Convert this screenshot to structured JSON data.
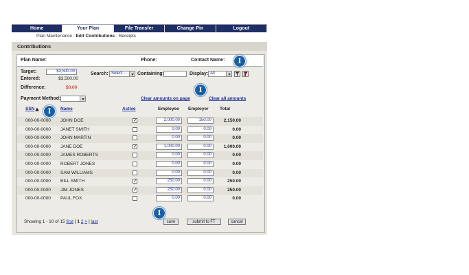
{
  "nav": {
    "tabs": [
      "Home",
      "Your Plan",
      "File Transfer",
      "Change Pin",
      "Logout"
    ],
    "active": "Your Plan"
  },
  "breadcrumb": {
    "prefix": "Plan Maintenance :",
    "current": "Edit Contributions",
    "suffix": ": Receipts"
  },
  "section_title": "Contributions",
  "plan": {
    "plan_name_label": "Plan Name:",
    "phone_label": "Phone:",
    "contact_label": "Contact Name:"
  },
  "summary": {
    "target_label": "Target:",
    "target_value": "$3,500.00",
    "entered_label": "Entered:",
    "entered_value": "$3,500.00",
    "difference_label": "Difference:",
    "difference_value": "$0.00",
    "difference_color": "#cc0000"
  },
  "filters": {
    "search_label": "Search:",
    "search_value": "Select....",
    "containing_label": "Containing:",
    "containing_value": "",
    "display_label": "Display:",
    "display_value": "All"
  },
  "payment": {
    "label": "Payment Method:",
    "value": ""
  },
  "links": {
    "clear_page": "Clear amounts on page",
    "clear_all": "Clear all amounts"
  },
  "table": {
    "headers": {
      "ssn": "SSN",
      "name": "Name",
      "active": "Active",
      "employee": "Employee",
      "employer": "Employer",
      "total": "Total"
    },
    "rows": [
      {
        "ssn": "000-00-0000",
        "name": "JOHN DOE",
        "active": "✓",
        "employee": "2,000.00",
        "employer": "150.00",
        "total": "2,150.00"
      },
      {
        "ssn": "000-00-0000",
        "name": "JANET SMITH",
        "active": "",
        "employee": "0.00",
        "employer": "0.00",
        "total": "0.00"
      },
      {
        "ssn": "000-00-0000",
        "name": "JOHN MARTIN",
        "active": "",
        "employee": "0.00",
        "employer": "0.00",
        "total": "0.00"
      },
      {
        "ssn": "000-00-0000",
        "name": "JANE DOE",
        "active": "✓",
        "employee": "1,000.00",
        "employer": "0.00",
        "total": "1,000.00"
      },
      {
        "ssn": "000-00-0000",
        "name": "JAMES ROBERTS",
        "active": "",
        "employee": "0.00",
        "employer": "0.00",
        "total": "0.00"
      },
      {
        "ssn": "000-00-0000",
        "name": "ROBERT JONES",
        "active": "",
        "employee": "0.00",
        "employer": "0.00",
        "total": "0.00"
      },
      {
        "ssn": "000-00-0000",
        "name": "SAM WILLIAMS",
        "active": "",
        "employee": "0.00",
        "employer": "0.00",
        "total": "0.00"
      },
      {
        "ssn": "000-00-0000",
        "name": "BILL SMITH",
        "active": "✓",
        "employee": "250.00",
        "employer": "0.00",
        "total": "250.00"
      },
      {
        "ssn": "000-00-0000",
        "name": "JIM JONES",
        "active": "✓",
        "employee": "250.00",
        "employer": "0.00",
        "total": "250.00"
      },
      {
        "ssn": "000-00-0000",
        "name": "PAUL FOX",
        "active": "",
        "employee": "0.00",
        "employer": "0.00",
        "total": "0.00"
      }
    ]
  },
  "pagination": {
    "showing": "Showing 1 - 10 of 15",
    "first": "first",
    "open": "[",
    "p1": "1",
    "p2": "2",
    "next": ">",
    "close": "]",
    "last": "last"
  },
  "buttons": {
    "save": "save",
    "submit": "submit to FT",
    "cancel": "cancel"
  },
  "info_marker": "I",
  "colors": {
    "nav_bg": "#1f2f63",
    "link": "#1f2f9a",
    "info_bubble": "#1b5fa3",
    "input_text": "#2233aa"
  }
}
